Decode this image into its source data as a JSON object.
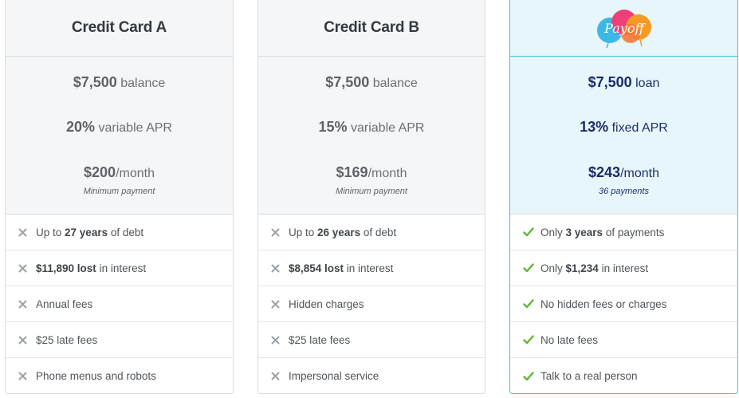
{
  "cards": [
    {
      "title": "Credit Card A",
      "stats": [
        {
          "strong": "$7,500",
          "rest": " balance"
        },
        {
          "strong": "20%",
          "rest": " variable APR"
        },
        {
          "strong": "$200",
          "rest": "/month"
        }
      ],
      "sub": "Minimum payment",
      "features": [
        {
          "icon": "x-icon",
          "pre": "Up to ",
          "strong": "27 years",
          "post": " of debt"
        },
        {
          "icon": "x-icon",
          "pre": "",
          "strong": "$11,890 lost",
          "post": " in interest"
        },
        {
          "icon": "x-icon",
          "pre": "Annual fees",
          "strong": "",
          "post": ""
        },
        {
          "icon": "x-icon",
          "pre": "$25 late fees",
          "strong": "",
          "post": ""
        },
        {
          "icon": "x-icon",
          "pre": "Phone menus and robots",
          "strong": "",
          "post": ""
        }
      ]
    },
    {
      "title": "Credit Card B",
      "stats": [
        {
          "strong": "$7,500",
          "rest": " balance"
        },
        {
          "strong": "15%",
          "rest": " variable APR"
        },
        {
          "strong": "$169",
          "rest": "/month"
        }
      ],
      "sub": "Minimum payment",
      "features": [
        {
          "icon": "x-icon",
          "pre": "Up to ",
          "strong": "26 years",
          "post": " of debt"
        },
        {
          "icon": "x-icon",
          "pre": "",
          "strong": "$8,854 lost",
          "post": " in interest"
        },
        {
          "icon": "x-icon",
          "pre": "Hidden charges",
          "strong": "",
          "post": ""
        },
        {
          "icon": "x-icon",
          "pre": "$25 late fees",
          "strong": "",
          "post": ""
        },
        {
          "icon": "x-icon",
          "pre": "Impersonal service",
          "strong": "",
          "post": ""
        }
      ]
    },
    {
      "logo_text": "Payoff",
      "stats": [
        {
          "strong": "$7,500",
          "rest": " loan"
        },
        {
          "strong": "13%",
          "rest": " fixed APR"
        },
        {
          "strong": "$243",
          "rest": "/month"
        }
      ],
      "sub": "36 payments",
      "features": [
        {
          "icon": "check-icon",
          "pre": "Only ",
          "strong": "3 years",
          "post": " of payments"
        },
        {
          "icon": "check-icon",
          "pre": "Only ",
          "strong": "$1,234",
          "post": " in interest"
        },
        {
          "icon": "check-icon",
          "pre": "No hidden fees or charges",
          "strong": "",
          "post": ""
        },
        {
          "icon": "check-icon",
          "pre": "No late fees",
          "strong": "",
          "post": ""
        },
        {
          "icon": "check-icon",
          "pre": "Talk to a real person",
          "strong": "",
          "post": ""
        }
      ]
    }
  ],
  "colors": {
    "x_mark": "#9aa0a6",
    "check_mark": "#5cb932",
    "payoff_accent": "#49c1d6",
    "payoff_text": "#1b2a68"
  }
}
